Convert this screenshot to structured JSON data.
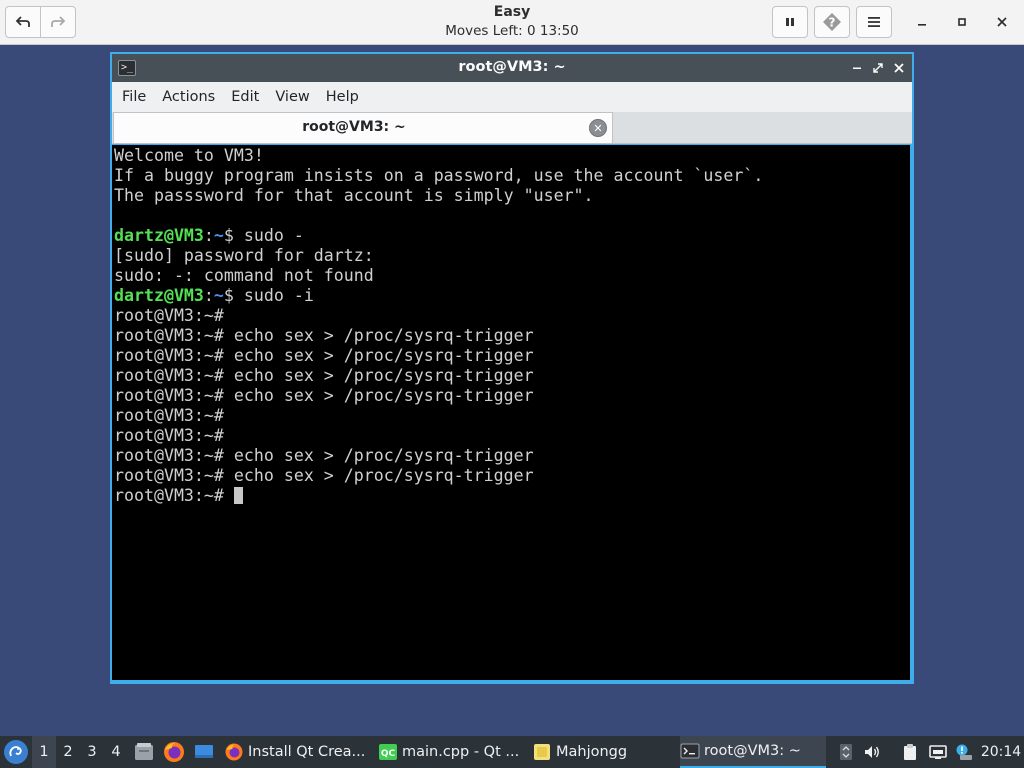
{
  "game": {
    "title": "Easy",
    "status": "Moves Left:  0   13:50"
  },
  "terminal": {
    "window_title": "root@VM3: ~",
    "tab_label": "root@VM3: ~",
    "menu": [
      "File",
      "Actions",
      "Edit",
      "View",
      "Help"
    ],
    "lines": [
      {
        "text": "Welcome to VM3!"
      },
      {
        "text": "If a buggy program insists on a password, use the account `user`."
      },
      {
        "text": "The passsword for that account is simply \"user\"."
      },
      {
        "text": ""
      },
      {
        "user": "dartz@VM3",
        "path": "~",
        "text": "$ sudo -"
      },
      {
        "text": "[sudo] password for dartz:"
      },
      {
        "text": "sudo: -: command not found"
      },
      {
        "user": "dartz@VM3",
        "path": "~",
        "text": "$ sudo -i"
      },
      {
        "text": "root@VM3:~#"
      },
      {
        "text": "root@VM3:~# echo sex > /proc/sysrq-trigger"
      },
      {
        "text": "root@VM3:~# echo sex > /proc/sysrq-trigger"
      },
      {
        "text": "root@VM3:~# echo sex > /proc/sysrq-trigger"
      },
      {
        "text": "root@VM3:~# echo sex > /proc/sysrq-trigger"
      },
      {
        "text": "root@VM3:~#"
      },
      {
        "text": "root@VM3:~#"
      },
      {
        "text": "root@VM3:~# echo sex > /proc/sysrq-trigger"
      },
      {
        "text": "root@VM3:~# echo sex > /proc/sysrq-trigger"
      },
      {
        "text": "root@VM3:~# ",
        "cursor": true
      }
    ]
  },
  "taskbar": {
    "desktops": [
      "1",
      "2",
      "3",
      "4"
    ],
    "tasks": [
      {
        "label": "Install Qt Crea...",
        "icon": "firefox-icon"
      },
      {
        "label": "main.cpp - Qt ...",
        "icon": "qt-creator-icon"
      },
      {
        "label": "Mahjongg",
        "icon": "mahjongg-icon"
      },
      {
        "label": "root@VM3: ~",
        "icon": "terminal-icon"
      }
    ],
    "clock": "20:14"
  },
  "colors": {
    "accent": "#3daee9",
    "desktop_bg": "#3a4a78",
    "terminal_bg": "#000000",
    "prompt_user": "#54e055",
    "prompt_path": "#4a8ff0"
  }
}
